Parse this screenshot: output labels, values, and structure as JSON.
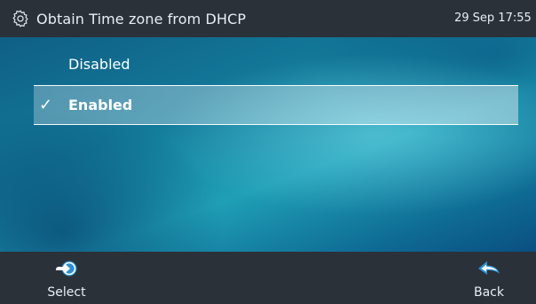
{
  "header": {
    "title": "Obtain Time zone from DHCP",
    "datetime": "29 Sep 17:55",
    "icon": "gear-icon"
  },
  "options": [
    {
      "label": "Disabled",
      "selected": false
    },
    {
      "label": "Enabled",
      "selected": true,
      "check_mark": "✓"
    }
  ],
  "softkeys": {
    "select_label": "Select",
    "back_label": "Back"
  },
  "colors": {
    "bar": "#2b3138",
    "accent": "#2c8fd6"
  }
}
